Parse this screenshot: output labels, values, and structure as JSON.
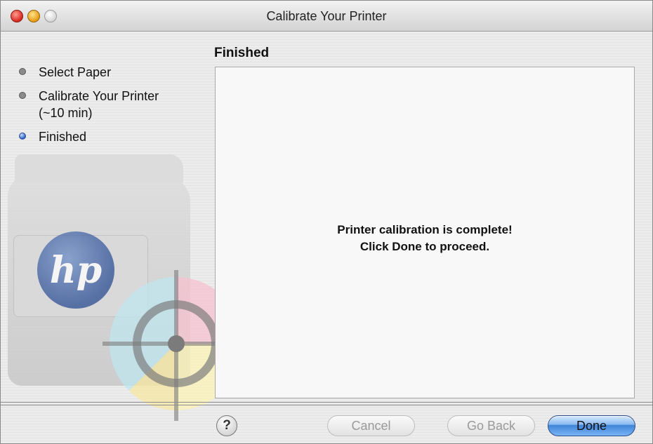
{
  "window": {
    "title": "Calibrate Your Printer"
  },
  "sidebar": {
    "steps": [
      {
        "label_line1": "Select Paper",
        "label_line2": ""
      },
      {
        "label_line1": "Calibrate Your Printer",
        "label_line2": "(~10 min)"
      },
      {
        "label_line1": "Finished",
        "label_line2": ""
      }
    ],
    "active_step": "Finished"
  },
  "main": {
    "section_title": "Finished",
    "message_line1": "Printer calibration is complete!",
    "message_line2": "Click Done to proceed."
  },
  "footer": {
    "help_label": "?",
    "cancel_label": "Cancel",
    "back_label": "Go Back",
    "done_label": "Done"
  },
  "colors": {
    "accent": "#3f84d8",
    "disabled_text": "#9a9a9a"
  }
}
